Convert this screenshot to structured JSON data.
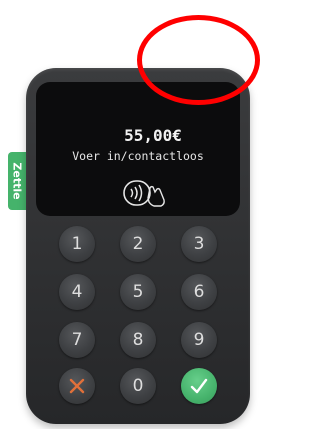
{
  "terminal": {
    "brand_label": "Zettle",
    "amount": "55,00€",
    "prompt": "Voer in/contactloos"
  },
  "keypad": {
    "keys": [
      "1",
      "2",
      "3",
      "4",
      "5",
      "6",
      "7",
      "8",
      "9",
      "",
      "0",
      ""
    ]
  },
  "colors": {
    "body": "#2f3032",
    "screen": "#0c0c0d",
    "brand_green": "#45b36b",
    "cancel_orange": "#e0703a",
    "annotation_red": "#ff0000"
  }
}
